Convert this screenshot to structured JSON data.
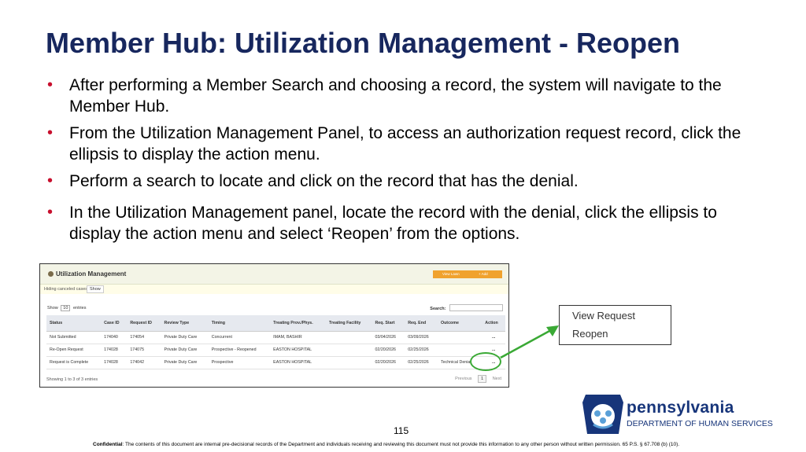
{
  "title": "Member Hub: Utilization Management - Reopen",
  "bullets": [
    "After performing a Member Search and choosing a record, the system will navigate to the Member Hub.",
    "From the Utilization Management Panel, to access an authorization request record, click the ellipsis to display the action menu.",
    "Perform a search to locate and click on the record that has the denial.",
    "In the Utilization Management panel, locate the record with the denial, click the ellipsis to display the action menu and select ‘Reopen’ from the options."
  ],
  "bullet_char": "•",
  "panel": {
    "title": "Utilization Management",
    "btn_view": "View Lawn",
    "btn_add": "+ Add",
    "hiding_text": "Hiding canceled cases.",
    "show_button": "Show",
    "show_label": "Show",
    "entries_select": "10",
    "entries_label": "entries",
    "search_label": "Search:",
    "columns": [
      "Status",
      "Case ID",
      "Request ID",
      "Review Type",
      "Timing",
      "Treating Prov./Phys.",
      "Treating Facility",
      "Req. Start",
      "Req. End",
      "Outcome",
      "Action"
    ],
    "rows": [
      [
        "Not Submitted",
        "174040",
        "174054",
        "Private Duty Care",
        "Concurrent",
        "IMAM, BASHIR",
        "",
        "03/04/2026",
        "03/09/2026",
        "",
        "..."
      ],
      [
        "Re-Open Request",
        "174028",
        "174075",
        "Private Duty Care",
        "Prospective - Reopened",
        "EASTON HOSPITAL",
        "",
        "02/20/2026",
        "02/25/2026",
        "",
        "..."
      ],
      [
        "Request is Complete",
        "174028",
        "174042",
        "Private Duty Care",
        "Prospective",
        "EASTON HOSPITAL",
        "",
        "02/20/2026",
        "02/25/2026",
        "Technical Denial",
        "..."
      ]
    ],
    "footer_info": "Showing 1 to 3 of 3 entries",
    "pager": {
      "previous": "Previous",
      "page": "1",
      "next": "Next"
    }
  },
  "action_menu": [
    "View Request",
    "Reopen"
  ],
  "page_number": "115",
  "confidential_label": "Confidential",
  "confidential_text": ": The contents of this document are internal pre-decisional records of the Department and individuals receiving and reviewing this document must not provide this information to any other person without written permission. 65 P.S. § 67.708 (b) (10).",
  "logo": {
    "name": "pennsylvania",
    "dept": "DEPARTMENT OF HUMAN SERVICES"
  },
  "colors": {
    "title": "#17275e",
    "bullet": "#c8102e",
    "highlight": "#3aa935",
    "brand": "#17357a",
    "accent": "#f0a22e"
  }
}
